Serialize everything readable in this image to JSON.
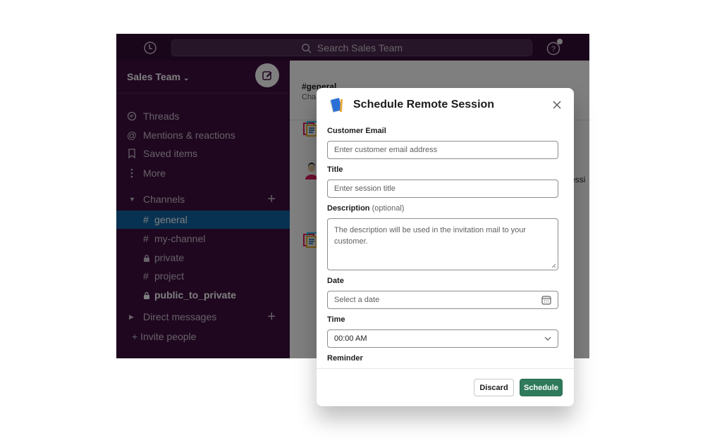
{
  "topbar": {
    "search_placeholder": "Search Sales Team",
    "history_icon": "clock-icon",
    "help_icon": "question-circle-icon"
  },
  "sidebar": {
    "workspace_name": "Sales Team",
    "workspace_chevron": "⌄",
    "nav_items": [
      {
        "label": "Threads",
        "icon": "threads-icon"
      },
      {
        "label": "Mentions & reactions",
        "icon": "at-icon"
      },
      {
        "label": "Saved items",
        "icon": "bookmark-icon"
      },
      {
        "label": "More",
        "icon": "more-vertical-icon"
      }
    ],
    "channels_header": "Channels",
    "channels": [
      {
        "name": "general",
        "prefix": "#",
        "active": true,
        "bold": false
      },
      {
        "name": "my-channel",
        "prefix": "#",
        "active": false,
        "bold": false
      },
      {
        "name": "private",
        "prefix": "lock",
        "active": false,
        "bold": false
      },
      {
        "name": "project",
        "prefix": "#",
        "active": false,
        "bold": false
      },
      {
        "name": "public_to_private",
        "prefix": "lock",
        "active": false,
        "bold": true
      }
    ],
    "dm_header": "Direct messages",
    "invite_label": "+ Invite people"
  },
  "main": {
    "channel_title": "#general",
    "channel_subtitle": "Cha",
    "message_fragment": "essi"
  },
  "modal": {
    "title": "Schedule Remote Session",
    "fields": {
      "email": {
        "label": "Customer Email",
        "placeholder": "Enter customer email address"
      },
      "title": {
        "label": "Title",
        "placeholder": "Enter session title"
      },
      "description": {
        "label": "Description",
        "optional": "(optional)",
        "placeholder": "The description will be used in the invitation mail to your customer."
      },
      "date": {
        "label": "Date",
        "placeholder": "Select a date"
      },
      "time": {
        "label": "Time",
        "value": "00:00 AM"
      },
      "reminder": {
        "label": "Reminder"
      }
    },
    "buttons": {
      "discard": "Discard",
      "schedule": "Schedule"
    },
    "colors": {
      "primary": "#2f7a5b"
    }
  },
  "colors": {
    "sidebar_bg": "#3f0e40",
    "active_channel": "#1164a3"
  }
}
